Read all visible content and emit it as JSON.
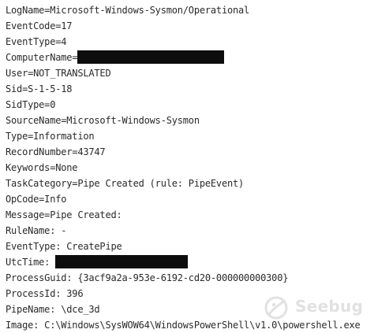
{
  "lines": {
    "logname": "LogName=Microsoft-Windows-Sysmon/Operational",
    "eventcode": "EventCode=17",
    "eventtype": "EventType=4",
    "computername": "ComputerName=",
    "user": "User=NOT_TRANSLATED",
    "sid": "Sid=S-1-5-18",
    "sidtype": "SidType=0",
    "sourcename": "SourceName=Microsoft-Windows-Sysmon",
    "type": "Type=Information",
    "recordnumber": "RecordNumber=43747",
    "keywords": "Keywords=None",
    "taskcategory": "TaskCategory=Pipe Created (rule: PipeEvent)",
    "opcode": "OpCode=Info",
    "message": "Message=Pipe Created:",
    "rulename": "RuleName: -",
    "eventtype2": "EventType: CreatePipe",
    "utctime": "UtcTime: ",
    "processguid": "ProcessGuid: {3acf9a2a-953e-6192-cd20-000000000300}",
    "processid": "ProcessId: 396",
    "pipename": "PipeName: \\dce_3d",
    "image": "Image: C:\\Windows\\SysWOW64\\WindowsPowerShell\\v1.0\\powershell.exe"
  },
  "watermark": {
    "text": "Seebug",
    "icon": "seebug-logo-icon"
  }
}
